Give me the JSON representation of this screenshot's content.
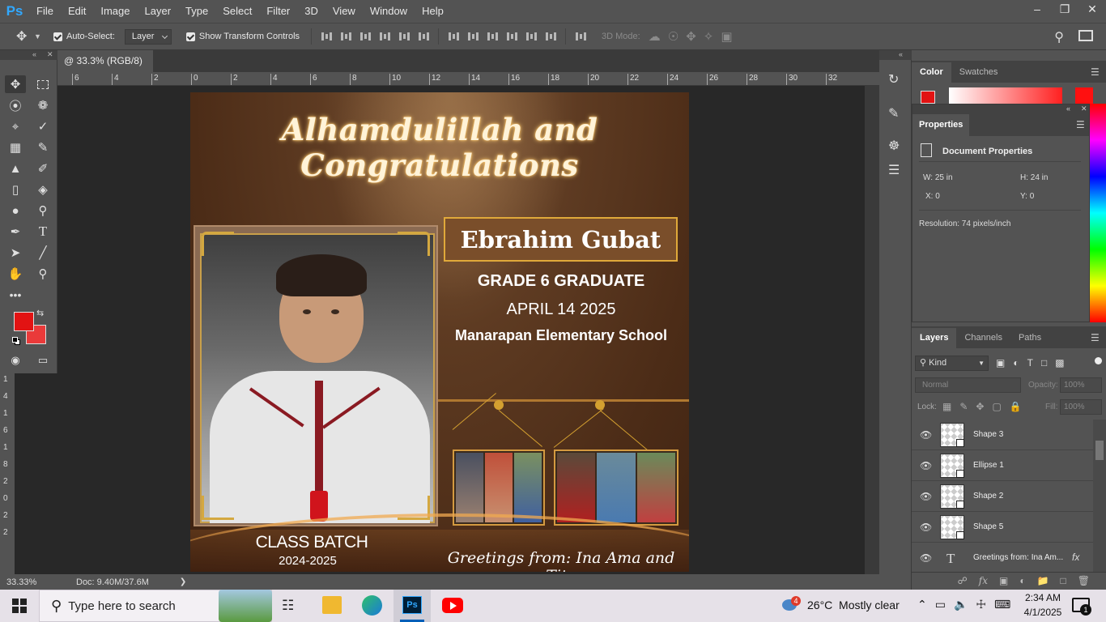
{
  "app": {
    "logo": "Ps",
    "menus": [
      "File",
      "Edit",
      "Image",
      "Layer",
      "Type",
      "Select",
      "Filter",
      "3D",
      "View",
      "Window",
      "Help"
    ]
  },
  "options_bar": {
    "auto_select_label": "Auto-Select:",
    "auto_select_value": "Layer",
    "show_transform_label": "Show Transform Controls",
    "mode_label": "3D Mode:"
  },
  "document": {
    "tab_title": "@ 33.3% (RGB/8) *",
    "zoom": "33.33%",
    "doc_size": "Doc: 9.40M/37.6M"
  },
  "ruler": {
    "h_ticks": [
      "6",
      "4",
      "2",
      "0",
      "2",
      "4",
      "6",
      "8",
      "10",
      "12",
      "14",
      "16",
      "18",
      "20",
      "22",
      "24",
      "26",
      "28",
      "30",
      "32"
    ],
    "v_ticks": [
      "1",
      "4",
      "1",
      "6",
      "1",
      "8",
      "2",
      "0",
      "2",
      "2"
    ]
  },
  "poster": {
    "headline": "Alhamdulillah and Congratulations",
    "name": "Ebrahim Gubat",
    "grade": "GRADE 6 GRADUATE",
    "date": "APRIL 14 2025",
    "school": "Manarapan Elementary School",
    "class_batch": "CLASS BATCH",
    "years": "2024-2025",
    "greetings": "Greetings from: Ina Ama and Tito"
  },
  "color_panel": {
    "tabs": [
      "Color",
      "Swatches"
    ],
    "foreground": "#e21313",
    "background": "#ea3a3a"
  },
  "properties": {
    "title": "Properties",
    "section": "Document Properties",
    "w_label": "W:",
    "w_value": "25 in",
    "h_label": "H:",
    "h_value": "24 in",
    "x_label": "X:",
    "x_value": "0",
    "y_label": "Y:",
    "y_value": "0",
    "resolution": "Resolution: 74 pixels/inch"
  },
  "layers": {
    "tabs": [
      "Layers",
      "Channels",
      "Paths"
    ],
    "filter_kind": "Kind",
    "blend_mode": "Normal",
    "opacity_label": "Opacity:",
    "opacity_value": "100%",
    "lock_label": "Lock:",
    "fill_label": "Fill:",
    "fill_value": "100%",
    "items": [
      {
        "name": "Shape 3",
        "kind": "shape"
      },
      {
        "name": "Ellipse 1",
        "kind": "shape"
      },
      {
        "name": "Shape 2",
        "kind": "shape"
      },
      {
        "name": "Shape 5",
        "kind": "shape"
      },
      {
        "name": "Greetings from: Ina Am...",
        "kind": "text"
      }
    ]
  },
  "taskbar": {
    "search_placeholder": "Type here to search",
    "weather": "26°C  Mostly clear",
    "time": "2:34 AM",
    "date": "4/1/2025",
    "notification_count": "1",
    "weather_badge": "4"
  }
}
